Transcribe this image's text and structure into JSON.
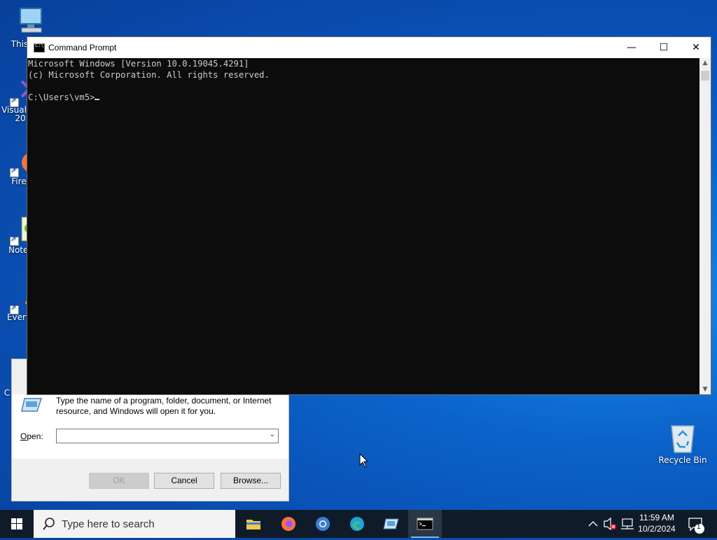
{
  "desktop": {
    "icons": [
      {
        "label": "This",
        "icon": "computer-icon"
      },
      {
        "label": "Visual",
        "label2": "20",
        "icon": "visual-studio-icon"
      },
      {
        "label": "Fire",
        "icon": "firefox-icon"
      },
      {
        "label": "Notep",
        "icon": "notepad-icon"
      },
      {
        "label": "Every",
        "icon": "everything-icon"
      },
      {
        "label": "C",
        "icon": "partial-icon"
      }
    ],
    "recycle_bin": {
      "label": "Recycle Bin",
      "icon": "recycle-bin-icon"
    }
  },
  "cmd": {
    "title": "Command Prompt",
    "lines": [
      "Microsoft Windows [Version 10.0.19045.4291]",
      "(c) Microsoft Corporation. All rights reserved.",
      "",
      "C:\\Users\\vm5>"
    ],
    "min_glyph": "—",
    "max_glyph": "☐",
    "close_glyph": "✕"
  },
  "run": {
    "description": "Type the name of a program, folder, document, or Internet resource, and Windows will open it for you.",
    "open_label": "Open:",
    "open_value": "",
    "ok_label": "OK",
    "cancel_label": "Cancel",
    "browse_label": "Browse..."
  },
  "taskbar": {
    "search_placeholder": "Type here to search",
    "apps": [
      "file-explorer-icon",
      "firefox-icon",
      "chrome-icon",
      "edge-icon",
      "run-icon",
      "cmd-icon"
    ],
    "time": "11:59 AM",
    "date": "10/2/2024",
    "notification_count": "1"
  },
  "colors": {
    "taskbar": "#101b2a",
    "console_bg": "#0c0c0c",
    "console_fg": "#cccccc",
    "accent": "#76b9ed"
  }
}
